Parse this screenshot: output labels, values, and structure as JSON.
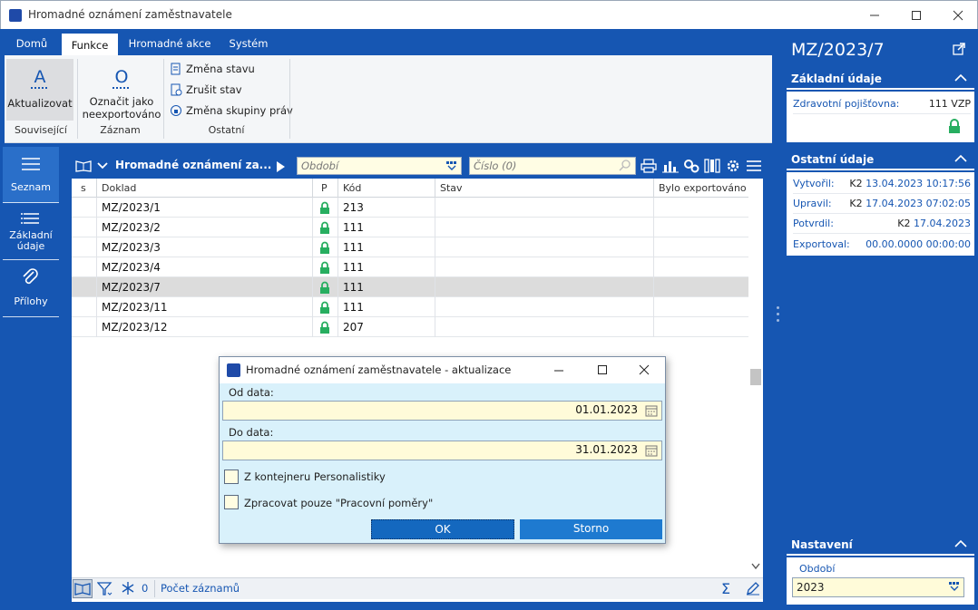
{
  "window": {
    "title": "Hromadné oznámení zaměstnavatele"
  },
  "ribbon": {
    "tabs": [
      "Domů",
      "Funkce",
      "Hromadné akce",
      "Systém"
    ],
    "buttons": {
      "aktualizovat": "Aktualizovat",
      "oznacit_line1": "Označit jako",
      "oznacit_line2": "neexportováno",
      "zmena_stavu": "Změna stavu",
      "zrusit_stav": "Zrušit stav",
      "zmena_skupiny": "Změna skupiny práv"
    },
    "groups": [
      "Související",
      "Záznam",
      "Ostatní"
    ]
  },
  "sidenav": [
    {
      "label": "Seznam",
      "icon": "list-lines-icon"
    },
    {
      "label1": "Základní",
      "label2": "údaje",
      "icon": "details-list-icon"
    },
    {
      "label": "Přílohy",
      "icon": "paperclip-icon"
    }
  ],
  "grid": {
    "title": "Hromadné oznámení za...",
    "filter_obdobi_placeholder": "Období",
    "filter_cislo_placeholder": "Číslo (0)",
    "columns": [
      "s",
      "Doklad",
      "P",
      "Kód",
      "Stav",
      "Bylo exportováno"
    ],
    "rows": [
      {
        "doklad": "MZ/2023/1",
        "kod": "213"
      },
      {
        "doklad": "MZ/2023/2",
        "kod": "111"
      },
      {
        "doklad": "MZ/2023/3",
        "kod": "111"
      },
      {
        "doklad": "MZ/2023/4",
        "kod": "111"
      },
      {
        "doklad": "MZ/2023/7",
        "kod": "111"
      },
      {
        "doklad": "MZ/2023/11",
        "kod": "111"
      },
      {
        "doklad": "MZ/2023/12",
        "kod": "207"
      }
    ],
    "selected_row": 4,
    "status": {
      "count": "0",
      "label": "Počet záznamů"
    }
  },
  "right": {
    "title": "MZ/2023/7",
    "zakladni": {
      "header": "Základní údaje",
      "label": "Zdravotní pojišťovna:",
      "value": "111 VZP"
    },
    "ostatni": {
      "header": "Ostatní údaje",
      "vytvoril_label": "Vytvořil:",
      "vytvoril_user": "K2",
      "vytvoril_date": "13.04.2023 10:17:56",
      "upravil_label": "Upravil:",
      "upravil_user": "K2",
      "upravil_date": "17.04.2023 07:02:05",
      "potvrdil_label": "Potvrdil:",
      "potvrdil_user": "K2",
      "potvrdil_date": "17.04.2023",
      "exportoval_label": "Exportoval:",
      "exportoval_date": "00.00.0000 00:00:00"
    },
    "nastaveni": {
      "header": "Nastavení",
      "obdobi_label": "Období",
      "obdobi_value": "2023"
    }
  },
  "dialog": {
    "title": "Hromadné oznámení zaměstnavatele - aktualizace",
    "od_label": "Od data:",
    "od_value": "01.01.2023",
    "do_label": "Do data:",
    "do_value": "31.01.2023",
    "chk1_label": "Z kontejneru Personalistiky",
    "chk2_label": "Zpracovat pouze \"Pracovní poměry\"",
    "ok_label": "OK",
    "storno_label": "Storno"
  },
  "colors": {
    "accent": "#1656b2",
    "lock": "#27ae60",
    "dialog_bg": "#d9f1fb",
    "input_bg": "#fffbd9"
  }
}
